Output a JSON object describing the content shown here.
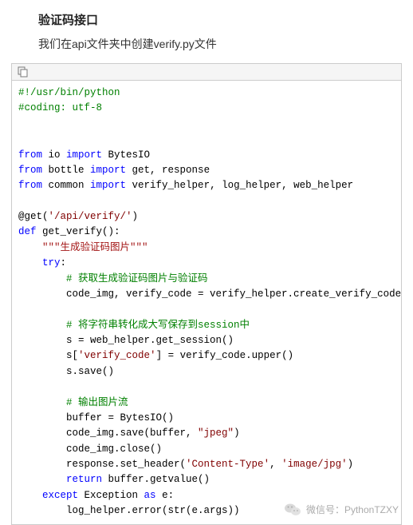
{
  "header": {
    "title": "验证码接口",
    "subtitle": "我们在api文件夹中创建verify.py文件"
  },
  "code": {
    "c1": "#!/usr/bin/python",
    "c2": "#coding: utf-8",
    "kw_from": "from",
    "kw_import": "import",
    "kw_def": "def",
    "kw_try": "try",
    "kw_except": "except",
    "kw_as": "as",
    "kw_return": "return",
    "mod_io": " io ",
    "imp_bytesio": " BytesIO",
    "mod_bottle": " bottle ",
    "imp_get_resp": " get, response",
    "mod_common": " common ",
    "imp_helpers": " verify_helper, log_helper, web_helper",
    "dec_at": "@get(",
    "dec_route": "'/api/verify/'",
    "dec_close": ")",
    "fn_def_tail": " get_verify():",
    "doc": "\"\"\"生成验证码图片\"\"\"",
    "try_tail": ":",
    "cmt1": "# 获取生成验证码图片与验证码",
    "l_assign": "code_img, verify_code = verify_helper.create_verify_code()",
    "cmt2": "# 将字符串转化成大写保存到session中",
    "l_sess": "s = web_helper.get_session()",
    "l_sk1": "s[",
    "l_sk_key": "'verify_code'",
    "l_sk2": "] = verify_code.upper()",
    "l_save": "s.save()",
    "cmt3": "# 输出图片流",
    "l_buf": "buffer = BytesIO()",
    "l_savebuf1": "code_img.save(buffer, ",
    "l_savebuf_s": "\"jpeg\"",
    "l_savebuf2": ")",
    "l_close": "code_img.close()",
    "l_hdr1": "response.set_header(",
    "l_hdr_s1": "'Content-Type'",
    "l_hdr_mid": ", ",
    "l_hdr_s2": "'image/jpg'",
    "l_hdr2": ")",
    "ret_tail": " buffer.getvalue()",
    "exc_mid": " Exception ",
    "exc_tail": " e:",
    "l_err": "log_helper.error(str(e.args))"
  },
  "watermark": {
    "label": "微信号：PythonTZXY"
  }
}
